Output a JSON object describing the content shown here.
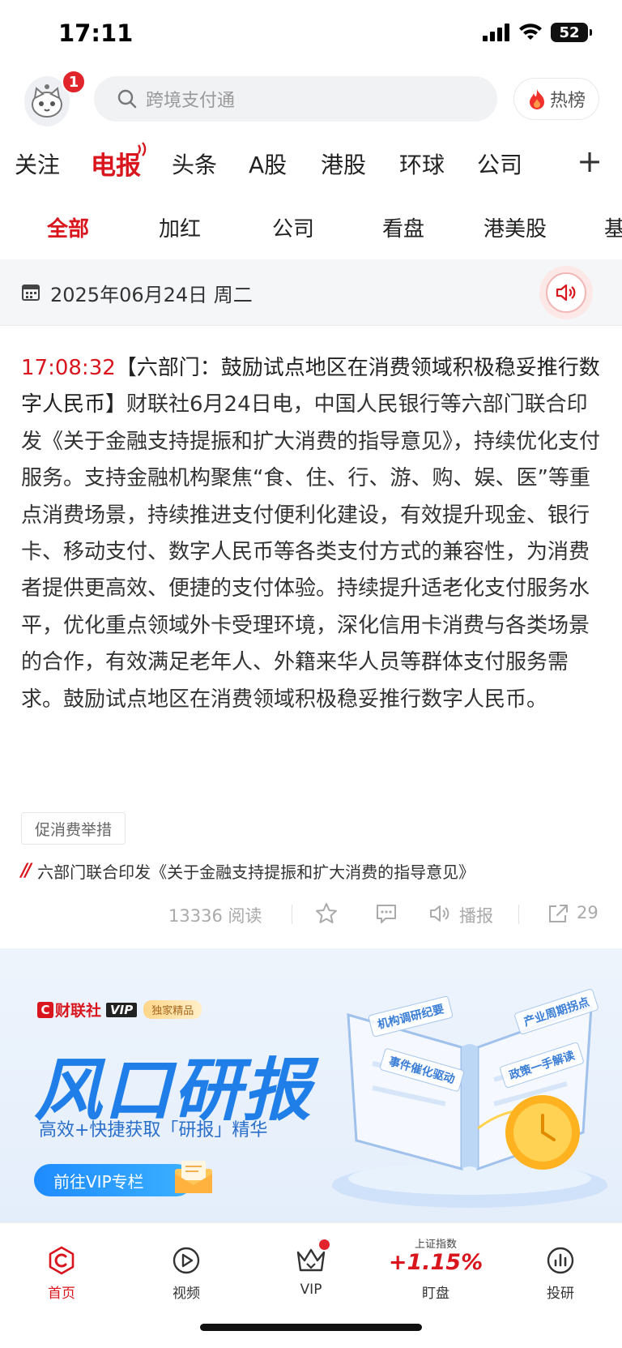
{
  "status_bar": {
    "time": "17:11",
    "battery": "52"
  },
  "header": {
    "notification_count": "1",
    "search_placeholder": "跨境支付通",
    "hot_label": "热榜"
  },
  "main_nav": {
    "items": [
      "关注",
      "电报",
      "头条",
      "A股",
      "港股",
      "环球",
      "公司"
    ],
    "active": "电报"
  },
  "sub_nav": {
    "items": [
      "全部",
      "加红",
      "公司",
      "看盘",
      "港美股",
      "基"
    ],
    "active": "全部"
  },
  "date_bar": {
    "date": "2025年06月24日  周二"
  },
  "article": {
    "timestamp": "17:08:32",
    "title": "【六部门：鼓励试点地区在消费领域积极稳妥推行数字人民币】",
    "body": "财联社6月24日电，中国人民银行等六部门联合印发《关于金融支持提振和扩大消费的指导意见》，持续优化支付服务。支持金融机构聚焦“食、住、行、游、购、娱、医”等重点消费场景，持续推进支付便利化建设，有效提升现金、银行卡、移动支付、数字人民币等各类支付方式的兼容性，为消费者提供更高效、便捷的支付体验。持续提升适老化支付服务水平，优化重点领域外卡受理环境，深化信用卡消费与各类场景的合作，有效满足老年人、外籍来华人员等群体支付服务需求。鼓励试点地区在消费领域积极稳妥推行数字人民币。",
    "tag": "促消费举措",
    "related_title": "六部门联合印发《关于金融支持提振和扩大消费的指导意见》",
    "read_count": "13336",
    "read_label": "阅读",
    "broadcast_label": "播报",
    "share_count": "29"
  },
  "banner": {
    "brand": "财联社",
    "brand_vip": "VIP",
    "exclusive": "独家精品",
    "headline": "风口研报",
    "subtitle": "高效+快捷获取「研报」精华",
    "cta": "前往VIP专栏",
    "chips": [
      "机构调研纪要",
      "产业周期拐点",
      "事件催化驱动",
      "政策一手解读"
    ]
  },
  "tab_bar": {
    "items": [
      {
        "label": "首页",
        "icon": "home-c-icon"
      },
      {
        "label": "视频",
        "icon": "play-icon"
      },
      {
        "label": "VIP",
        "icon": "crown-icon"
      },
      {
        "label": "盯盘",
        "icon": "index-ticker"
      },
      {
        "label": "投研",
        "icon": "chart-icon"
      }
    ],
    "index_name": "上证指数",
    "index_change": "+1.15%",
    "active": "首页"
  },
  "colors": {
    "accent": "#d9161e",
    "vip_blue": "#1f7ee8"
  }
}
